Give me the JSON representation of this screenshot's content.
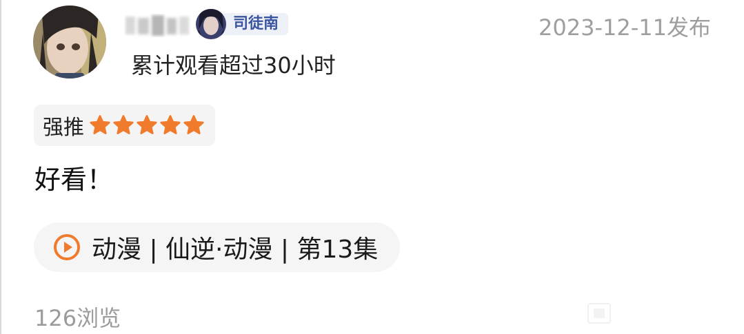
{
  "comment_card": {
    "timestamp": "2023-12-11发布",
    "badge": {
      "label": "司徒南"
    },
    "watch_time": "累计观看超过30小时",
    "rating": {
      "label": "强推",
      "stars": 5,
      "max_stars": 5
    },
    "comment_text": "好看！",
    "show_link": {
      "label": "动漫 | 仙逆·动漫 | 第13集",
      "icon": "play-circle-icon"
    },
    "views": "126浏览"
  },
  "colors": {
    "accent_orange": "#f07b2c",
    "badge_text": "#3a55a0",
    "muted_text": "#9e9e9e",
    "pill_bg": "#f5f5f5"
  }
}
